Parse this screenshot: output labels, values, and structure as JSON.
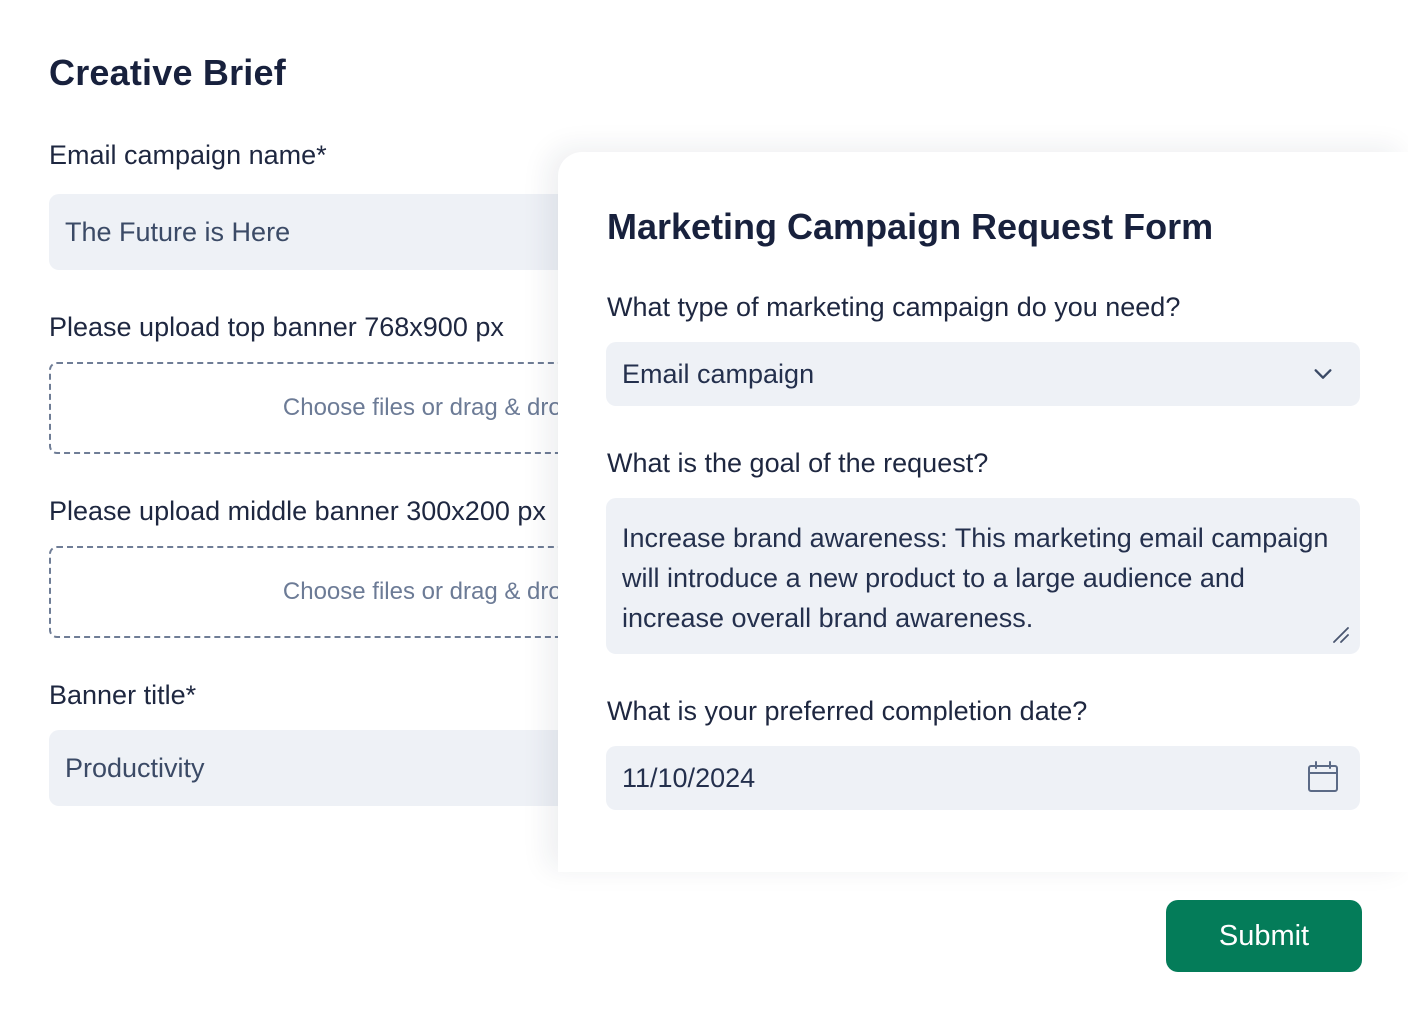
{
  "creative_brief": {
    "title": "Creative Brief",
    "campaign_name_label": "Email campaign name*",
    "campaign_name_value": "The Future is Here",
    "top_banner_label": "Please upload top banner 768x900 px",
    "top_banner_drop_text": "Choose files or drag & drop",
    "middle_banner_label": "Please upload middle banner 300x200 px",
    "middle_banner_drop_text": "Choose files or drag & drop",
    "banner_title_label": "Banner title*",
    "banner_title_value": "Productivity"
  },
  "request_form": {
    "title": "Marketing Campaign Request Form",
    "type_label": "What type of marketing campaign do you need?",
    "type_value": "Email campaign",
    "goal_label": "What is the goal of the request?",
    "goal_value": "Increase brand awareness: This marketing email campaign will introduce a new product to a large audience and increase overall brand awareness.",
    "date_label": "What is your preferred completion date?",
    "date_value": "11/10/2024"
  },
  "actions": {
    "submit_label": "Submit"
  },
  "icons": {
    "select": "chevron-down-icon",
    "date": "calendar-icon",
    "textarea": "resize-handle-icon"
  },
  "colors": {
    "text_dark": "#18213d",
    "input_bg": "#eef1f6",
    "placeholder": "#6c7b96",
    "submit_bg": "#047c59"
  }
}
